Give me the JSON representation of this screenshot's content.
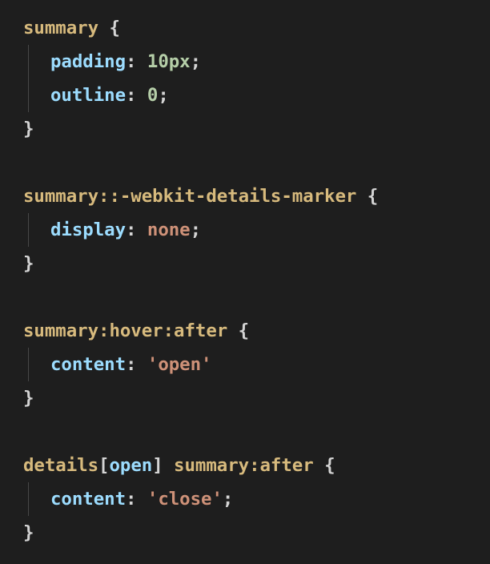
{
  "colors": {
    "background": "#1e1e1e",
    "selector": "#d7ba7d",
    "property": "#9cdcfe",
    "number": "#b5cea8",
    "string": "#ce9178",
    "punctuation": "#d4d4d4",
    "indent_guide": "#474747"
  },
  "rules": [
    {
      "selector": "summary",
      "open_brace": "{",
      "close_brace": "}",
      "declarations": [
        {
          "property": "padding",
          "colon": ":",
          "value": "10px",
          "semicolon": ";"
        },
        {
          "property": "outline",
          "colon": ":",
          "value": "0",
          "semicolon": ";"
        }
      ]
    },
    {
      "selector": "summary::-webkit-details-marker",
      "open_brace": "{",
      "close_brace": "}",
      "declarations": [
        {
          "property": "display",
          "colon": ":",
          "value": "none",
          "semicolon": ";"
        }
      ]
    },
    {
      "selector": "summary:hover:after",
      "open_brace": "{",
      "close_brace": "}",
      "declarations": [
        {
          "property": "content",
          "colon": ":",
          "value": "'open'",
          "semicolon": ""
        }
      ]
    },
    {
      "selector_parts": {
        "element": "details",
        "bracket_open": "[",
        "attribute": "open",
        "bracket_close": "]",
        "rest": " summary:after"
      },
      "open_brace": "{",
      "close_brace": "}",
      "declarations": [
        {
          "property": "content",
          "colon": ":",
          "value": "'close'",
          "semicolon": ";"
        }
      ]
    }
  ]
}
